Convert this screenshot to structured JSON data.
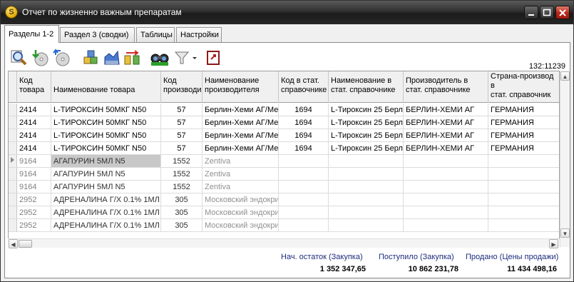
{
  "window": {
    "title": "Отчет по жизненно важным препаратам"
  },
  "tabs": [
    {
      "label": "Разделы 1-2"
    },
    {
      "label": "Раздел 3 (сводки)"
    },
    {
      "label": "Таблицы"
    },
    {
      "label": "Настройки"
    }
  ],
  "toolbar": {
    "counter": "132:11239",
    "icons": [
      "search-icon",
      "download-disk-icon",
      "refresh-disk-icon",
      "boxes-icon",
      "chart-icon",
      "transfer-icon",
      "binoculars-icon",
      "filter-icon",
      "exit-icon"
    ]
  },
  "grid": {
    "columns": [
      {
        "line1": "Код",
        "line2": "товара",
        "line3": ""
      },
      {
        "line1": "",
        "line2": "Наименование товара",
        "line3": ""
      },
      {
        "line1": "Код",
        "line2": "производи",
        "line3": ""
      },
      {
        "line1": "Наименование",
        "line2": "производителя",
        "line3": ""
      },
      {
        "line1": "Код в стат.",
        "line2": "справочнике",
        "line3": ""
      },
      {
        "line1": "Наименование в",
        "line2": "стат. справочнике",
        "line3": ""
      },
      {
        "line1": "Производитель в",
        "line2": "стат. справочнике",
        "line3": ""
      },
      {
        "line1": "Страна-производ",
        "line2": "в",
        "line3": "стат. справочник"
      }
    ],
    "rows": [
      {
        "code": "2414",
        "name": "L-ТИРОКСИН 50МКГ N50",
        "maker_code": "57",
        "maker": "Берлин-Хеми АГ/Мен",
        "stat_code": "1694",
        "stat_name": "L-Тироксин 25 Берли",
        "stat_maker": "БЕРЛИН-ХЕМИ АГ",
        "country": "ГЕРМАНИЯ"
      },
      {
        "code": "2414",
        "name": "L-ТИРОКСИН 50МКГ N50",
        "maker_code": "57",
        "maker": "Берлин-Хеми АГ/Мен",
        "stat_code": "1694",
        "stat_name": "L-Тироксин 25 Берли",
        "stat_maker": "БЕРЛИН-ХЕМИ АГ",
        "country": "ГЕРМАНИЯ"
      },
      {
        "code": "2414",
        "name": "L-ТИРОКСИН 50МКГ N50",
        "maker_code": "57",
        "maker": "Берлин-Хеми АГ/Мен",
        "stat_code": "1694",
        "stat_name": "L-Тироксин 25 Берли",
        "stat_maker": "БЕРЛИН-ХЕМИ АГ",
        "country": "ГЕРМАНИЯ"
      },
      {
        "code": "2414",
        "name": "L-ТИРОКСИН 50МКГ N50",
        "maker_code": "57",
        "maker": "Берлин-Хеми АГ/Мен",
        "stat_code": "1694",
        "stat_name": "L-Тироксин 25 Берли",
        "stat_maker": "БЕРЛИН-ХЕМИ АГ",
        "country": "ГЕРМАНИЯ"
      },
      {
        "code": "9164",
        "name": "АГАПУРИН 5МЛ N5",
        "maker_code": "1552",
        "maker": "Zentiva",
        "stat_code": "",
        "stat_name": "",
        "stat_maker": "",
        "country": ""
      },
      {
        "code": "9164",
        "name": "АГАПУРИН 5МЛ N5",
        "maker_code": "1552",
        "maker": "Zentiva",
        "stat_code": "",
        "stat_name": "",
        "stat_maker": "",
        "country": ""
      },
      {
        "code": "9164",
        "name": "АГАПУРИН 5МЛ N5",
        "maker_code": "1552",
        "maker": "Zentiva",
        "stat_code": "",
        "stat_name": "",
        "stat_maker": "",
        "country": ""
      },
      {
        "code": "2952",
        "name": "АДРЕНАЛИНА Г/Х 0.1% 1МЛ N",
        "maker_code": "305",
        "maker": "Московский эндокри",
        "stat_code": "",
        "stat_name": "",
        "stat_maker": "",
        "country": ""
      },
      {
        "code": "2952",
        "name": "АДРЕНАЛИНА Г/Х 0.1% 1МЛ N",
        "maker_code": "305",
        "maker": "Московский эндокри",
        "stat_code": "",
        "stat_name": "",
        "stat_maker": "",
        "country": ""
      },
      {
        "code": "2952",
        "name": "АДРЕНАЛИНА Г/Х 0.1% 1МЛ N",
        "maker_code": "305",
        "maker": "Московский эндокри",
        "stat_code": "",
        "stat_name": "",
        "stat_maker": "",
        "country": ""
      }
    ]
  },
  "totals": {
    "opening_label": "Нач. остаток (Закупка)",
    "opening_value": "1 352 347,65",
    "received_label": "Поступило (Закупка)",
    "received_value": "10 862 231,78",
    "sold_label": "Продано (Цены продажи)",
    "sold_value": "11 434 498,16"
  }
}
